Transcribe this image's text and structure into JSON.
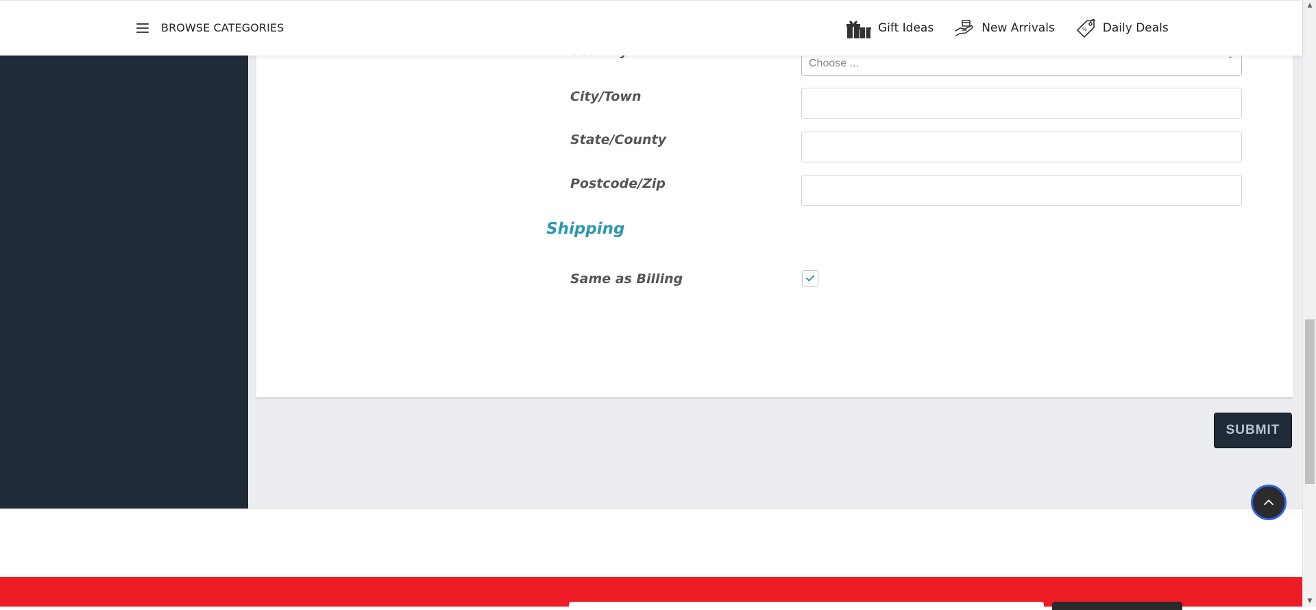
{
  "header": {
    "browse_label": "BROWSE CATEGORIES",
    "links": [
      {
        "label": "Gift Ideas",
        "icon": "gift-icon"
      },
      {
        "label": "New Arrivals",
        "icon": "hand-box-icon"
      },
      {
        "label": "Daily Deals",
        "icon": "price-tag-icon"
      }
    ]
  },
  "form": {
    "country_label": "Country",
    "country_placeholder": "Choose ...",
    "city_label": "City/Town",
    "city_value": "",
    "state_label": "State/County",
    "state_value": "",
    "postcode_label": "Postcode/Zip",
    "postcode_value": "",
    "shipping_heading": "Shipping",
    "same_as_billing_label": "Same as Billing",
    "same_as_billing_checked": true,
    "submit_label": "SUBMIT"
  },
  "colors": {
    "sidebar": "#1f2b36",
    "accent_heading": "#2b98b0",
    "footer_band": "#ee1c25",
    "scroll_top_ring": "#2f62e6"
  },
  "scroll_top": {
    "icon": "chevron-up-icon"
  }
}
